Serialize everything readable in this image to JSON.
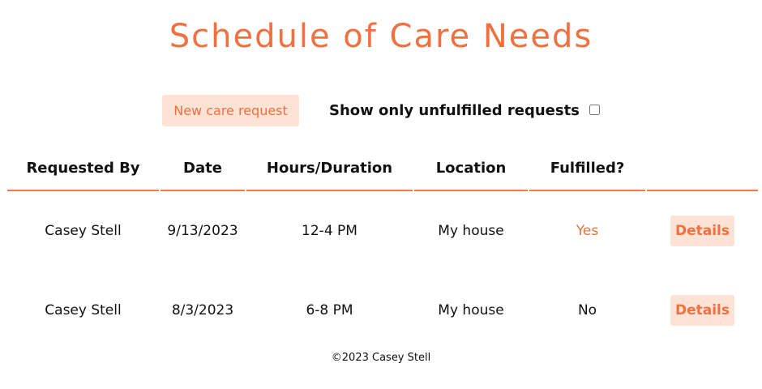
{
  "page": {
    "title": "Schedule of Care Needs",
    "footer": "©2023 Casey Stell"
  },
  "controls": {
    "new_request_label": "New care request",
    "filter_label": "Show only unfulfilled requests",
    "filter_checked": false
  },
  "table": {
    "headers": [
      "Requested By",
      "Date",
      "Hours/Duration",
      "Location",
      "Fulfilled?",
      ""
    ],
    "rows": [
      {
        "requested_by": "Casey Stell",
        "date": "9/13/2023",
        "hours": "12-4 PM",
        "location": "My house",
        "fulfilled": "Yes",
        "action": "Details"
      },
      {
        "requested_by": "Casey Stell",
        "date": "8/3/2023",
        "hours": "6-8 PM",
        "location": "My house",
        "fulfilled": "No",
        "action": "Details"
      }
    ]
  },
  "colors": {
    "accent": "#f07040",
    "button_bg": "#fde3d6",
    "rule": "#f07a4a"
  }
}
